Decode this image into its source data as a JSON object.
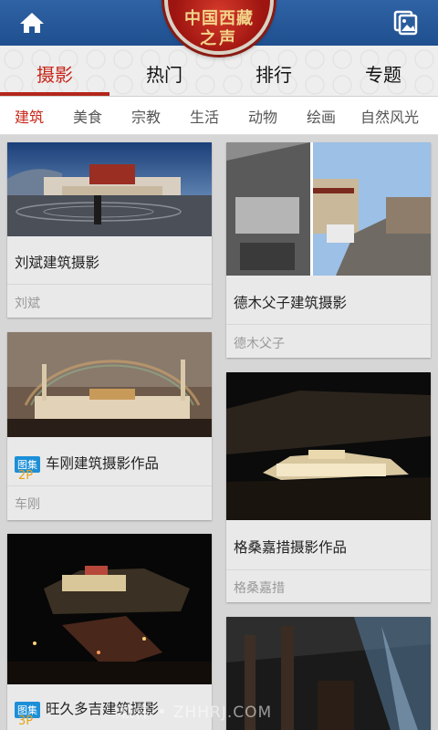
{
  "header": {
    "logo_line1": "中国西藏",
    "logo_line2": "之声",
    "home_icon": "home-icon",
    "gallery_icon": "gallery-icon"
  },
  "tabs": [
    {
      "label": "摄影",
      "active": true
    },
    {
      "label": "热门",
      "active": false
    },
    {
      "label": "排行",
      "active": false
    },
    {
      "label": "专题",
      "active": false
    }
  ],
  "subtabs": [
    {
      "label": "建筑",
      "active": true
    },
    {
      "label": "美食",
      "active": false
    },
    {
      "label": "宗教",
      "active": false
    },
    {
      "label": "生活",
      "active": false
    },
    {
      "label": "动物",
      "active": false
    },
    {
      "label": "绘画",
      "active": false
    },
    {
      "label": "自然风光",
      "active": false
    }
  ],
  "cards": [
    {
      "title": "刘斌建筑摄影",
      "author": "刘斌",
      "badge": "",
      "count": ""
    },
    {
      "title": "德木父子建筑摄影",
      "author": "德木父子",
      "badge": "",
      "count": ""
    },
    {
      "title": "车刚建筑摄影作品",
      "author": "车刚",
      "badge": "图集",
      "count": "2P"
    },
    {
      "title": "格桑嘉措摄影作品",
      "author": "格桑嘉措",
      "badge": "",
      "count": ""
    },
    {
      "title": "旺久多吉建筑摄影",
      "author": "",
      "badge": "图集",
      "count": "3P"
    },
    {
      "title": "",
      "author": "",
      "badge": "",
      "count": ""
    }
  ],
  "colors": {
    "accent": "#c8281b",
    "header_blue": "#2a5c9c",
    "badge_blue": "#1c8fd8",
    "count_orange": "#e8a317"
  },
  "watermark": "软件 • ZHHRJ.COM"
}
